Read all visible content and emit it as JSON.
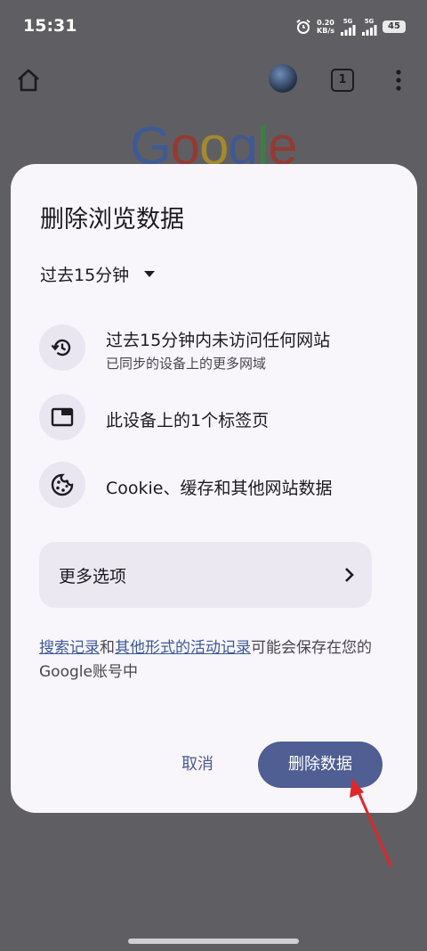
{
  "status_bar": {
    "time": "15:31",
    "net_speed_value": "0.20",
    "net_speed_unit": "KB/s",
    "signal_1_label": "5G",
    "signal_2_label": "5G",
    "battery": "45"
  },
  "browser": {
    "tab_count": "1",
    "logo_text": "Google"
  },
  "dialog": {
    "title": "删除浏览数据",
    "time_range": "过去15分钟",
    "items": [
      {
        "title": "过去15分钟内未访问任何网站",
        "subtitle": "已同步的设备上的更多网域",
        "icon": "history-icon"
      },
      {
        "title": "此设备上的1个标签页",
        "icon": "tab-icon"
      },
      {
        "title": "Cookie、缓存和其他网站数据",
        "icon": "cookie-icon"
      }
    ],
    "more_options": "更多选项",
    "note": {
      "link1": "搜索记录",
      "text1": "和",
      "link2": "其他形式的活动记录",
      "text2": "可能会保存在您的Google账号中"
    },
    "cancel": "取消",
    "delete": "删除数据"
  },
  "colors": {
    "scrim": "#5f5f63",
    "dialog_bg": "#f8f6fb",
    "primary": "#4f5e93",
    "annotation_arrow": "#e0262b"
  }
}
